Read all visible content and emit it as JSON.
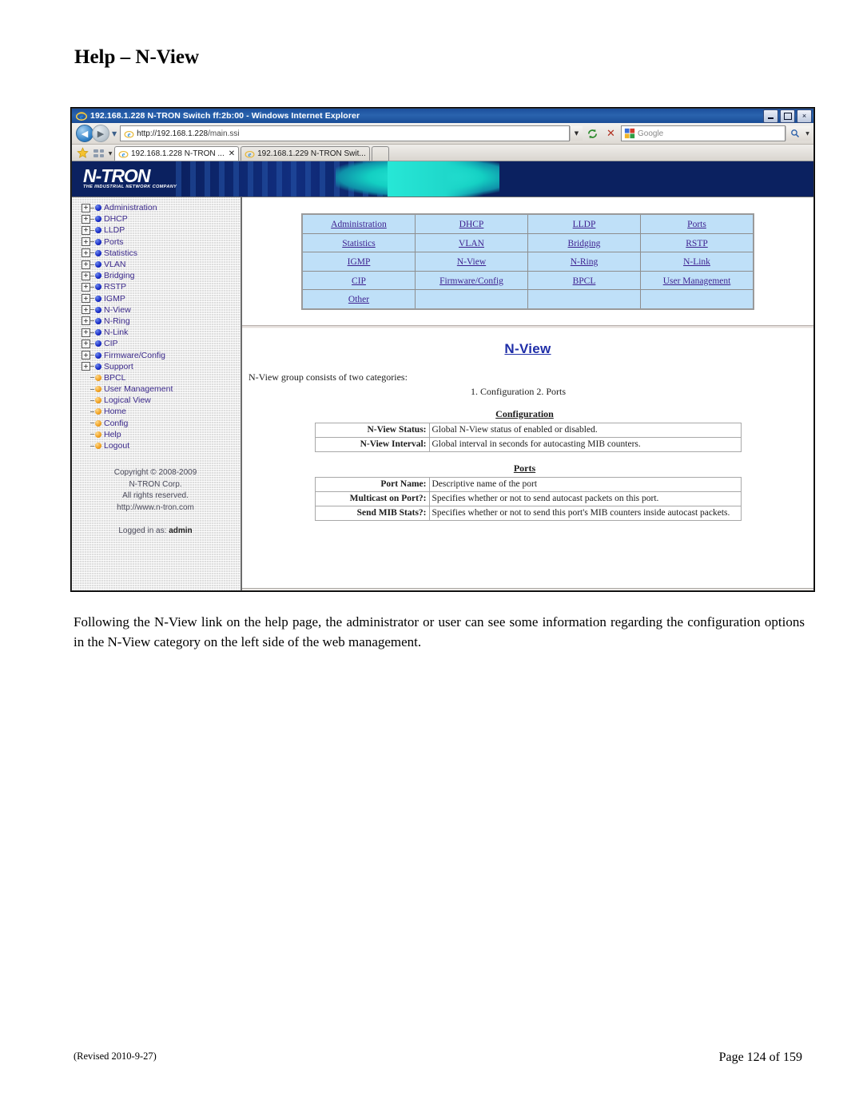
{
  "document": {
    "heading": "Help – N-View",
    "paragraph": "Following the N-View link on the help page, the administrator or user can see some information regarding the configuration options in the N-View category on the left side of the web management.",
    "footer_revised": "(Revised 2010-9-27)",
    "footer_page": "Page 124 of 159"
  },
  "browser": {
    "title": "192.168.1.228 N-TRON Switch ff:2b:00 - Windows Internet Explorer",
    "title_icon": "ie-logo-icon",
    "window_buttons": {
      "minimize": "minimize-icon",
      "maximize": "maximize-icon",
      "close": "×"
    },
    "nav": {
      "back_icon": "◀",
      "forward_icon": "▶",
      "history_dropdown_icon": "▼",
      "url_value": "http://192.168.1.228/main.ssi",
      "url_host": "http://192.168.1.228",
      "url_path": "/main.ssi",
      "url_dropdown_icon": "▼",
      "refresh_icon": "refresh-icon",
      "stop_icon": "✕",
      "search_placeholder": "Google",
      "search_engine_icon": "google-icon",
      "search_go_icon": "magnifier-icon",
      "search_dropdown_icon": "▼"
    },
    "tabs": {
      "favorites_icon": "star-icon",
      "quick_tabs_icon": "quick-tabs-icon",
      "tab_list_dropdown_icon": "▼",
      "items": [
        {
          "label": "192.168.1.228 N-TRON ...",
          "active": true,
          "close_icon": "✕"
        },
        {
          "label": "192.168.1.229 N-TRON Swit...",
          "active": false,
          "close_icon": ""
        }
      ]
    }
  },
  "webpage": {
    "banner": {
      "logo_text": "N-TRON",
      "logo_tagline": "THE INDUSTRIAL NETWORK COMPANY",
      "bg_color": "#0b2160",
      "accent_color": "#27e7d6"
    },
    "sidebar": {
      "tree": [
        {
          "label": "Administration",
          "expandable": true,
          "bullet": "blue"
        },
        {
          "label": "DHCP",
          "expandable": true,
          "bullet": "blue"
        },
        {
          "label": "LLDP",
          "expandable": true,
          "bullet": "blue"
        },
        {
          "label": "Ports",
          "expandable": true,
          "bullet": "blue"
        },
        {
          "label": "Statistics",
          "expandable": true,
          "bullet": "blue"
        },
        {
          "label": "VLAN",
          "expandable": true,
          "bullet": "blue"
        },
        {
          "label": "Bridging",
          "expandable": true,
          "bullet": "blue"
        },
        {
          "label": "RSTP",
          "expandable": true,
          "bullet": "blue"
        },
        {
          "label": "IGMP",
          "expandable": true,
          "bullet": "blue"
        },
        {
          "label": "N-View",
          "expandable": true,
          "bullet": "blue"
        },
        {
          "label": "N-Ring",
          "expandable": true,
          "bullet": "blue"
        },
        {
          "label": "N-Link",
          "expandable": true,
          "bullet": "blue"
        },
        {
          "label": "CIP",
          "expandable": true,
          "bullet": "blue"
        },
        {
          "label": "Firmware/Config",
          "expandable": true,
          "bullet": "blue"
        },
        {
          "label": "Support",
          "expandable": true,
          "bullet": "blue"
        },
        {
          "label": "BPCL",
          "expandable": false,
          "bullet": "orange"
        },
        {
          "label": "User Management",
          "expandable": false,
          "bullet": "orange"
        },
        {
          "label": "Logical View",
          "expandable": false,
          "bullet": "orange"
        },
        {
          "label": "Home",
          "expandable": false,
          "bullet": "orange"
        },
        {
          "label": "Config",
          "expandable": false,
          "bullet": "orange"
        },
        {
          "label": "Help",
          "expandable": false,
          "bullet": "orange"
        },
        {
          "label": "Logout",
          "expandable": false,
          "bullet": "orange"
        }
      ],
      "expand_icon": "+",
      "copyright_lines": [
        "Copyright © 2008-2009",
        "N-TRON Corp.",
        "All rights reserved.",
        "http://www.n-tron.com"
      ],
      "logged_in_label": "Logged in as:",
      "logged_in_user": "admin"
    },
    "help_index": {
      "rows": [
        [
          "Administration",
          "DHCP",
          "LLDP",
          "Ports"
        ],
        [
          "Statistics",
          "VLAN",
          "Bridging",
          "RSTP"
        ],
        [
          "IGMP",
          "N-View",
          "N-Ring",
          "N-Link"
        ],
        [
          "CIP",
          "Firmware/Config",
          "BPCL",
          "User Management"
        ],
        [
          "Other",
          "",
          "",
          ""
        ]
      ],
      "cell_bg": "#bfe0f8",
      "link_color": "#3d1f8f"
    },
    "nview_help": {
      "title": "N-View",
      "intro": "N-View group consists of two categories:",
      "categories": "1. Configuration   2. Ports",
      "sections": [
        {
          "heading": "Configuration",
          "rows": [
            {
              "label": "N-View Status:",
              "value": "Global N-View status of enabled or disabled."
            },
            {
              "label": "N-View Interval:",
              "value": "Global interval in seconds for autocasting MIB counters."
            }
          ]
        },
        {
          "heading": "Ports",
          "rows": [
            {
              "label": "Port Name:",
              "value": "Descriptive name of the port"
            },
            {
              "label": "Multicast on Port?:",
              "value": "Specifies whether or not to send autocast packets on this port."
            },
            {
              "label": "Send MIB Stats?:",
              "value": "Specifies whether or not to send this port's MIB counters inside autocast packets."
            }
          ]
        }
      ]
    }
  }
}
